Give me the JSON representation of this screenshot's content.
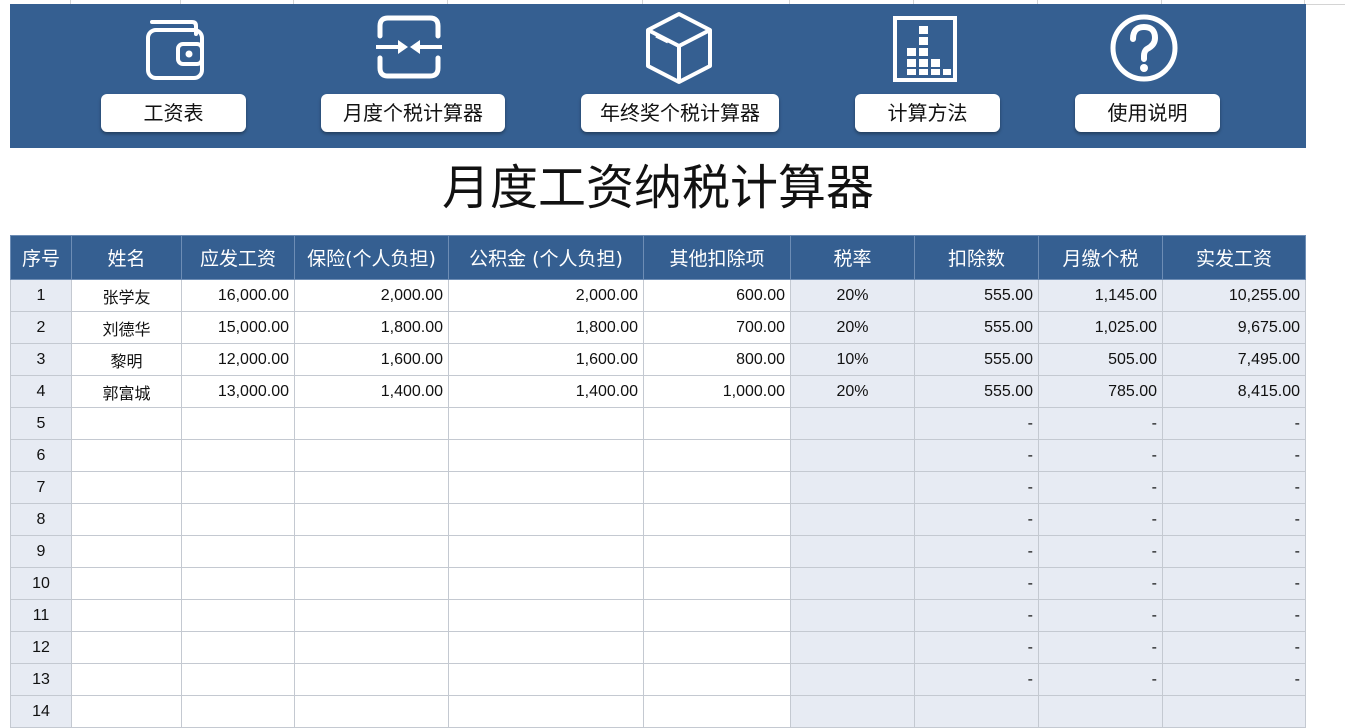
{
  "nav": [
    {
      "icon": "wallet-icon",
      "label": "工资表"
    },
    {
      "icon": "exchange-arrows-icon",
      "label": "月度个税计算器"
    },
    {
      "icon": "box-icon",
      "label": "年终奖个税计算器"
    },
    {
      "icon": "bar-blocks-icon",
      "label": "计算方法"
    },
    {
      "icon": "question-circle-icon",
      "label": "使用说明"
    }
  ],
  "title": "月度工资纳税计算器",
  "table": {
    "headers": [
      "序号",
      "姓名",
      "应发工资",
      "保险(个人负担)",
      "公积金 (个人负担)",
      "其他扣除项",
      "税率",
      "扣除数",
      "月缴个税",
      "实发工资"
    ],
    "rows": [
      [
        "1",
        "张学友",
        "16,000.00",
        "2,000.00",
        "2,000.00",
        "600.00",
        "20%",
        "555.00",
        "1,145.00",
        "10,255.00"
      ],
      [
        "2",
        "刘德华",
        "15,000.00",
        "1,800.00",
        "1,800.00",
        "700.00",
        "20%",
        "555.00",
        "1,025.00",
        "9,675.00"
      ],
      [
        "3",
        "黎明",
        "12,000.00",
        "1,600.00",
        "1,600.00",
        "800.00",
        "10%",
        "555.00",
        "505.00",
        "7,495.00"
      ],
      [
        "4",
        "郭富城",
        "13,000.00",
        "1,400.00",
        "1,400.00",
        "1,000.00",
        "20%",
        "555.00",
        "785.00",
        "8,415.00"
      ],
      [
        "5",
        "",
        "",
        "",
        "",
        "",
        "",
        "-",
        "-",
        "-"
      ],
      [
        "6",
        "",
        "",
        "",
        "",
        "",
        "",
        "-",
        "-",
        "-"
      ],
      [
        "7",
        "",
        "",
        "",
        "",
        "",
        "",
        "-",
        "-",
        "-"
      ],
      [
        "8",
        "",
        "",
        "",
        "",
        "",
        "",
        "-",
        "-",
        "-"
      ],
      [
        "9",
        "",
        "",
        "",
        "",
        "",
        "",
        "-",
        "-",
        "-"
      ],
      [
        "10",
        "",
        "",
        "",
        "",
        "",
        "",
        "-",
        "-",
        "-"
      ],
      [
        "11",
        "",
        "",
        "",
        "",
        "",
        "",
        "-",
        "-",
        "-"
      ],
      [
        "12",
        "",
        "",
        "",
        "",
        "",
        "",
        "-",
        "-",
        "-"
      ],
      [
        "13",
        "",
        "",
        "",
        "",
        "",
        "",
        "-",
        "-",
        "-"
      ],
      [
        "14",
        "",
        "",
        "",
        "",
        "",
        "",
        "",
        "",
        ""
      ]
    ]
  },
  "colors": {
    "banner": "#355f91",
    "header": "#355f91",
    "calc_fill": "#e7ebf3"
  }
}
